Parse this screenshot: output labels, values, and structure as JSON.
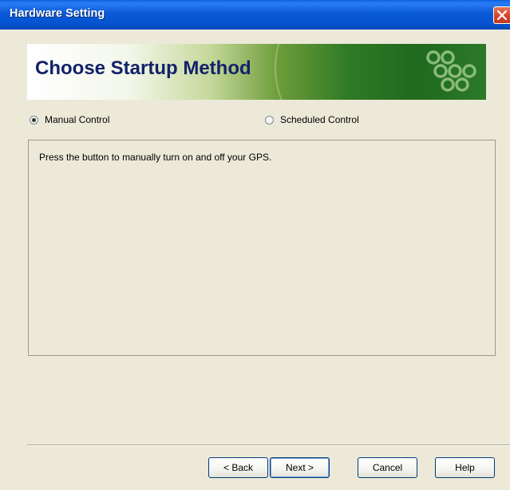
{
  "window": {
    "title": "Hardware Setting"
  },
  "banner": {
    "title": "Choose Startup Method"
  },
  "options": {
    "manual_label": "Manual Control",
    "scheduled_label": "Scheduled Control",
    "selected": "Manual Control"
  },
  "content": {
    "description": "Press the button to manually turn on and off your GPS."
  },
  "buttons": {
    "back": "< Back",
    "next": "Next >",
    "cancel": "Cancel",
    "help": "Help"
  },
  "colors": {
    "titlebar": "#0553d0",
    "banner_title": "#13226a",
    "banner_green": "#2f7a26",
    "dialog_bg": "#ece9d8",
    "close_button": "#d8452a"
  },
  "icons": {
    "close": "close-icon",
    "logo": "chain-links-logo"
  }
}
